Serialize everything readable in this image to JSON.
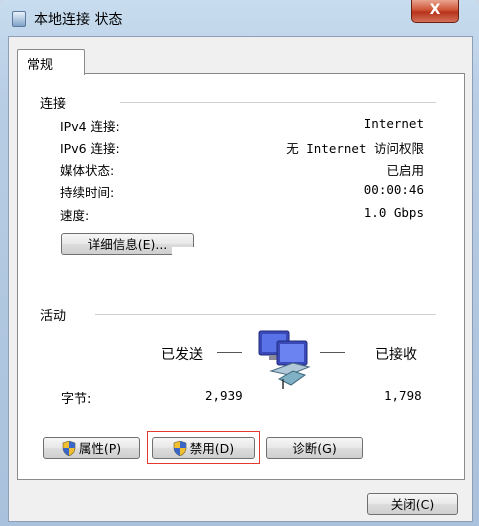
{
  "window": {
    "title": "本地连接 状态",
    "close_label": "X"
  },
  "tabs": [
    {
      "label": "常规"
    }
  ],
  "connection": {
    "group_label": "连接",
    "rows": [
      {
        "label": "IPv4 连接:",
        "value": "Internet"
      },
      {
        "label": "IPv6 连接:",
        "value": "无 Internet 访问权限"
      },
      {
        "label": "媒体状态:",
        "value": "已启用"
      },
      {
        "label": "持续时间:",
        "value": "00:00:46"
      },
      {
        "label": "速度:",
        "value": "1.0 Gbps"
      }
    ],
    "details_button": "详细信息(E)..."
  },
  "activity": {
    "group_label": "活动",
    "sent_label": "已发送",
    "received_label": "已接收",
    "bytes_label": "字节:",
    "bytes_sent": "2,939",
    "bytes_received": "1,798"
  },
  "buttons": {
    "properties": "属性(P)",
    "disable": "禁用(D)",
    "diagnose": "诊断(G)",
    "close": "关闭(C)"
  },
  "icons": {
    "window": "network-adapter-icon",
    "activity": "network-computers-icon",
    "uac": "uac-shield-icon"
  },
  "colors": {
    "highlight_border": "#e23a2e",
    "titlebar": "#b7cde4",
    "close_button": "#c7462c"
  }
}
